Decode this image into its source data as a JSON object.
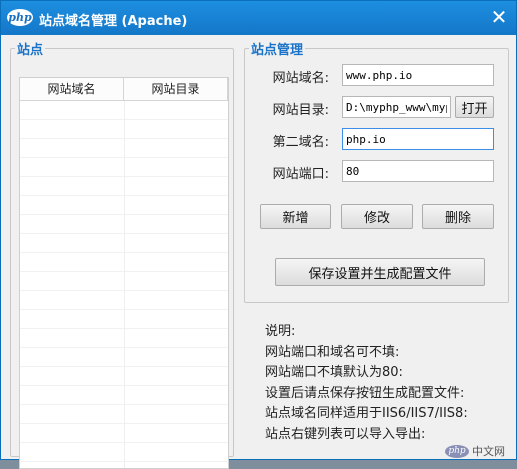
{
  "window": {
    "logo": "php",
    "title": "站点域名管理 (Apache)",
    "close_glyph": "✕"
  },
  "sites": {
    "legend": "站点",
    "columns": [
      "网站域名",
      "网站目录"
    ]
  },
  "management": {
    "legend": "站点管理",
    "domain_label": "网站域名:",
    "domain_value": "www.php.io",
    "dir_label": "网站目录:",
    "dir_value": "D:\\myphp_www\\myphp",
    "open_button": "打开",
    "second_domain_label": "第二域名:",
    "second_domain_value": "php.io",
    "port_label": "网站端口:",
    "port_value": "80",
    "add_button": "新增",
    "edit_button": "修改",
    "delete_button": "删除",
    "save_button": "保存设置并生成配置文件"
  },
  "notes": [
    "说明:",
    "网站端口和域名可不填:",
    "网站端口不填默认为80:",
    "设置后请点保存按钮生成配置文件:",
    "站点域名同样适用于IIS6/IIS7/IIS8:",
    "站点右键列表可以导入导出:"
  ],
  "watermark": {
    "logo": "php",
    "text": "中文网"
  }
}
